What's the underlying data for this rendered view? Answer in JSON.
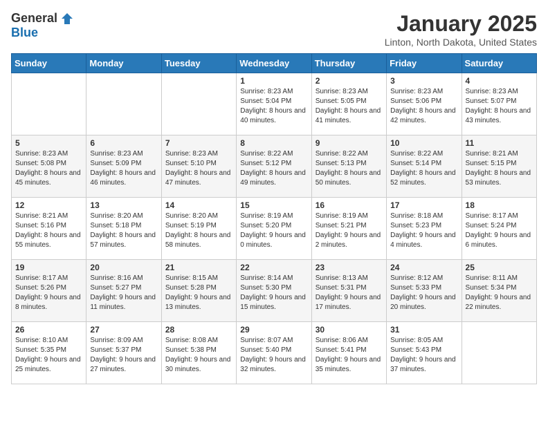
{
  "header": {
    "logo_general": "General",
    "logo_blue": "Blue",
    "month_title": "January 2025",
    "location": "Linton, North Dakota, United States"
  },
  "days_of_week": [
    "Sunday",
    "Monday",
    "Tuesday",
    "Wednesday",
    "Thursday",
    "Friday",
    "Saturday"
  ],
  "weeks": [
    [
      {
        "day": "",
        "sunrise": "",
        "sunset": "",
        "daylight": ""
      },
      {
        "day": "",
        "sunrise": "",
        "sunset": "",
        "daylight": ""
      },
      {
        "day": "",
        "sunrise": "",
        "sunset": "",
        "daylight": ""
      },
      {
        "day": "1",
        "sunrise": "Sunrise: 8:23 AM",
        "sunset": "Sunset: 5:04 PM",
        "daylight": "Daylight: 8 hours and 40 minutes."
      },
      {
        "day": "2",
        "sunrise": "Sunrise: 8:23 AM",
        "sunset": "Sunset: 5:05 PM",
        "daylight": "Daylight: 8 hours and 41 minutes."
      },
      {
        "day": "3",
        "sunrise": "Sunrise: 8:23 AM",
        "sunset": "Sunset: 5:06 PM",
        "daylight": "Daylight: 8 hours and 42 minutes."
      },
      {
        "day": "4",
        "sunrise": "Sunrise: 8:23 AM",
        "sunset": "Sunset: 5:07 PM",
        "daylight": "Daylight: 8 hours and 43 minutes."
      }
    ],
    [
      {
        "day": "5",
        "sunrise": "Sunrise: 8:23 AM",
        "sunset": "Sunset: 5:08 PM",
        "daylight": "Daylight: 8 hours and 45 minutes."
      },
      {
        "day": "6",
        "sunrise": "Sunrise: 8:23 AM",
        "sunset": "Sunset: 5:09 PM",
        "daylight": "Daylight: 8 hours and 46 minutes."
      },
      {
        "day": "7",
        "sunrise": "Sunrise: 8:23 AM",
        "sunset": "Sunset: 5:10 PM",
        "daylight": "Daylight: 8 hours and 47 minutes."
      },
      {
        "day": "8",
        "sunrise": "Sunrise: 8:22 AM",
        "sunset": "Sunset: 5:12 PM",
        "daylight": "Daylight: 8 hours and 49 minutes."
      },
      {
        "day": "9",
        "sunrise": "Sunrise: 8:22 AM",
        "sunset": "Sunset: 5:13 PM",
        "daylight": "Daylight: 8 hours and 50 minutes."
      },
      {
        "day": "10",
        "sunrise": "Sunrise: 8:22 AM",
        "sunset": "Sunset: 5:14 PM",
        "daylight": "Daylight: 8 hours and 52 minutes."
      },
      {
        "day": "11",
        "sunrise": "Sunrise: 8:21 AM",
        "sunset": "Sunset: 5:15 PM",
        "daylight": "Daylight: 8 hours and 53 minutes."
      }
    ],
    [
      {
        "day": "12",
        "sunrise": "Sunrise: 8:21 AM",
        "sunset": "Sunset: 5:16 PM",
        "daylight": "Daylight: 8 hours and 55 minutes."
      },
      {
        "day": "13",
        "sunrise": "Sunrise: 8:20 AM",
        "sunset": "Sunset: 5:18 PM",
        "daylight": "Daylight: 8 hours and 57 minutes."
      },
      {
        "day": "14",
        "sunrise": "Sunrise: 8:20 AM",
        "sunset": "Sunset: 5:19 PM",
        "daylight": "Daylight: 8 hours and 58 minutes."
      },
      {
        "day": "15",
        "sunrise": "Sunrise: 8:19 AM",
        "sunset": "Sunset: 5:20 PM",
        "daylight": "Daylight: 9 hours and 0 minutes."
      },
      {
        "day": "16",
        "sunrise": "Sunrise: 8:19 AM",
        "sunset": "Sunset: 5:21 PM",
        "daylight": "Daylight: 9 hours and 2 minutes."
      },
      {
        "day": "17",
        "sunrise": "Sunrise: 8:18 AM",
        "sunset": "Sunset: 5:23 PM",
        "daylight": "Daylight: 9 hours and 4 minutes."
      },
      {
        "day": "18",
        "sunrise": "Sunrise: 8:17 AM",
        "sunset": "Sunset: 5:24 PM",
        "daylight": "Daylight: 9 hours and 6 minutes."
      }
    ],
    [
      {
        "day": "19",
        "sunrise": "Sunrise: 8:17 AM",
        "sunset": "Sunset: 5:26 PM",
        "daylight": "Daylight: 9 hours and 8 minutes."
      },
      {
        "day": "20",
        "sunrise": "Sunrise: 8:16 AM",
        "sunset": "Sunset: 5:27 PM",
        "daylight": "Daylight: 9 hours and 11 minutes."
      },
      {
        "day": "21",
        "sunrise": "Sunrise: 8:15 AM",
        "sunset": "Sunset: 5:28 PM",
        "daylight": "Daylight: 9 hours and 13 minutes."
      },
      {
        "day": "22",
        "sunrise": "Sunrise: 8:14 AM",
        "sunset": "Sunset: 5:30 PM",
        "daylight": "Daylight: 9 hours and 15 minutes."
      },
      {
        "day": "23",
        "sunrise": "Sunrise: 8:13 AM",
        "sunset": "Sunset: 5:31 PM",
        "daylight": "Daylight: 9 hours and 17 minutes."
      },
      {
        "day": "24",
        "sunrise": "Sunrise: 8:12 AM",
        "sunset": "Sunset: 5:33 PM",
        "daylight": "Daylight: 9 hours and 20 minutes."
      },
      {
        "day": "25",
        "sunrise": "Sunrise: 8:11 AM",
        "sunset": "Sunset: 5:34 PM",
        "daylight": "Daylight: 9 hours and 22 minutes."
      }
    ],
    [
      {
        "day": "26",
        "sunrise": "Sunrise: 8:10 AM",
        "sunset": "Sunset: 5:35 PM",
        "daylight": "Daylight: 9 hours and 25 minutes."
      },
      {
        "day": "27",
        "sunrise": "Sunrise: 8:09 AM",
        "sunset": "Sunset: 5:37 PM",
        "daylight": "Daylight: 9 hours and 27 minutes."
      },
      {
        "day": "28",
        "sunrise": "Sunrise: 8:08 AM",
        "sunset": "Sunset: 5:38 PM",
        "daylight": "Daylight: 9 hours and 30 minutes."
      },
      {
        "day": "29",
        "sunrise": "Sunrise: 8:07 AM",
        "sunset": "Sunset: 5:40 PM",
        "daylight": "Daylight: 9 hours and 32 minutes."
      },
      {
        "day": "30",
        "sunrise": "Sunrise: 8:06 AM",
        "sunset": "Sunset: 5:41 PM",
        "daylight": "Daylight: 9 hours and 35 minutes."
      },
      {
        "day": "31",
        "sunrise": "Sunrise: 8:05 AM",
        "sunset": "Sunset: 5:43 PM",
        "daylight": "Daylight: 9 hours and 37 minutes."
      },
      {
        "day": "",
        "sunrise": "",
        "sunset": "",
        "daylight": ""
      }
    ]
  ]
}
